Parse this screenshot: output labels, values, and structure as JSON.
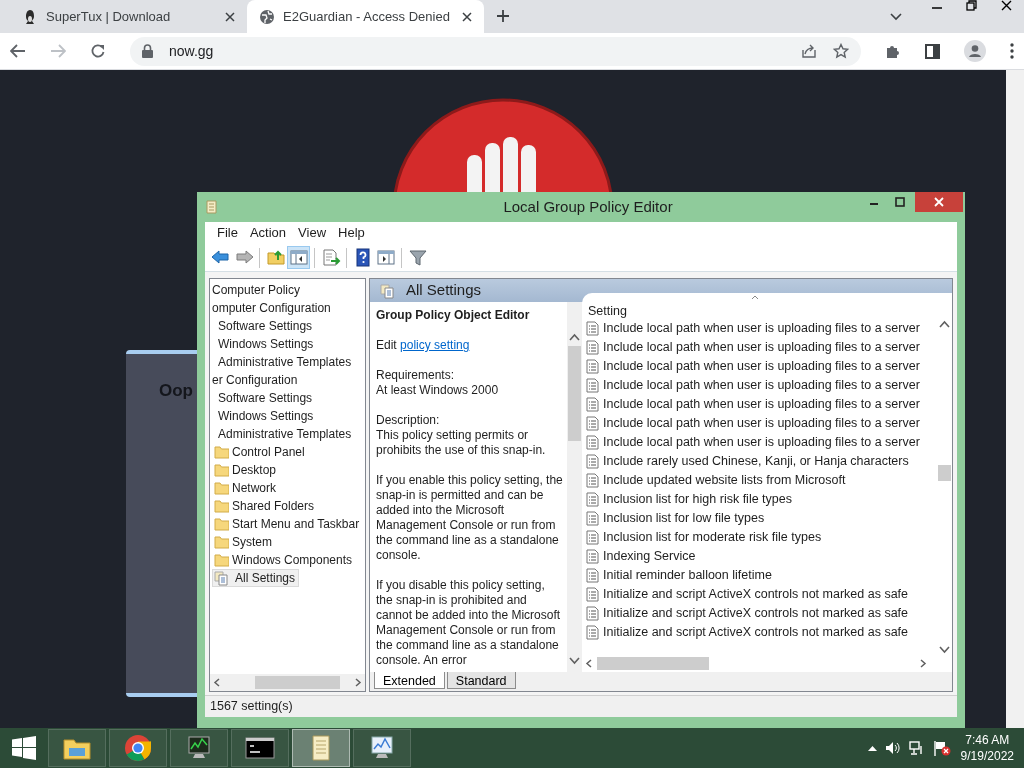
{
  "browser": {
    "tabs": [
      {
        "title": "SuperTux | Download",
        "selected": false,
        "kind": "penguin"
      },
      {
        "title": "E2Guardian - Access Denied",
        "selected": true,
        "kind": "globe"
      }
    ],
    "address": "now.gg"
  },
  "page": {
    "card_heading": "Oop"
  },
  "window": {
    "title": "Local Group Policy Editor",
    "menu": [
      "File",
      "Action",
      "View",
      "Help"
    ],
    "toolbar": [
      [
        {
          "kind": "back",
          "pressed": false
        },
        {
          "kind": "forward",
          "pressed": false
        }
      ],
      [
        {
          "kind": "folder-up",
          "pressed": false
        },
        {
          "kind": "tree-toggle",
          "pressed": true
        }
      ],
      [
        {
          "kind": "export",
          "pressed": false
        }
      ],
      [
        {
          "kind": "help",
          "pressed": false
        },
        {
          "kind": "action-pane",
          "pressed": false
        }
      ],
      [
        {
          "kind": "filter",
          "pressed": false
        }
      ]
    ],
    "tree": [
      {
        "label": "Computer Policy",
        "selected": false,
        "children": [
          {
            "label": "omputer Configuration",
            "selected": false,
            "children": [
              {
                "label": "Software Settings",
                "selected": false
              },
              {
                "label": "Windows Settings",
                "selected": false
              },
              {
                "label": "Administrative Templates",
                "selected": false
              }
            ]
          },
          {
            "label": "er Configuration",
            "selected": false,
            "children": [
              {
                "label": "Software Settings",
                "selected": false
              },
              {
                "label": "Windows Settings",
                "selected": false
              },
              {
                "label": "Administrative Templates",
                "selected": false,
                "children": [
                  {
                    "label": "Control Panel",
                    "selected": false,
                    "kind": "folder"
                  },
                  {
                    "label": "Desktop",
                    "selected": false,
                    "kind": "folder"
                  },
                  {
                    "label": "Network",
                    "selected": false,
                    "kind": "folder"
                  },
                  {
                    "label": "Shared Folders",
                    "selected": false,
                    "kind": "folder"
                  },
                  {
                    "label": "Start Menu and Taskbar",
                    "selected": false,
                    "kind": "folder"
                  },
                  {
                    "label": "System",
                    "selected": false,
                    "kind": "folder"
                  },
                  {
                    "label": "Windows Components",
                    "selected": false,
                    "kind": "folder"
                  },
                  {
                    "label": "All Settings",
                    "selected": true,
                    "kind": "all-settings"
                  }
                ]
              }
            ]
          }
        ]
      }
    ],
    "header": "All Settings",
    "description": {
      "title": "Group Policy Object Editor",
      "edit_prefix": "Edit",
      "edit_link": "policy setting",
      "requirements_label": "Requirements:",
      "requirements": "At least Windows 2000",
      "description_label": "Description:",
      "paragraphs": [
        "This policy setting permits or prohibits the use of this snap-in.",
        "If you enable this policy setting, the snap-in is permitted and can be added into the Microsoft Management Console or run from the command line as a standalone console.",
        "If you disable this policy setting, the snap-in is prohibited and cannot be added into the Microsoft Management Console or run from the command line as a standalone console. An error"
      ]
    },
    "view_tabs": [
      {
        "label": "Extended",
        "selected": true
      },
      {
        "label": "Standard",
        "selected": false
      }
    ],
    "list": {
      "column": "Setting",
      "rows": [
        "Include local path when user is uploading files to a server",
        "Include local path when user is uploading files to a server",
        "Include local path when user is uploading files to a server",
        "Include local path when user is uploading files to a server",
        "Include local path when user is uploading files to a server",
        "Include local path when user is uploading files to a server",
        "Include local path when user is uploading files to a server",
        "Include rarely used Chinese, Kanji, or Hanja characters",
        "Include updated website lists from Microsoft",
        "Inclusion list for high risk file types",
        "Inclusion list for low file types",
        "Inclusion list for moderate risk file types",
        "Indexing Service",
        "Initial reminder balloon lifetime",
        "Initialize and script ActiveX controls not marked as safe",
        "Initialize and script ActiveX controls not marked as safe",
        "Initialize and script ActiveX controls not marked as safe"
      ]
    },
    "status": "1567 setting(s)"
  },
  "taskbar": {
    "apps": [
      {
        "kind": "explorer",
        "selected": false
      },
      {
        "kind": "chrome",
        "selected": false
      },
      {
        "kind": "perfmon",
        "selected": false
      },
      {
        "kind": "cmd",
        "selected": false
      },
      {
        "kind": "gpedit",
        "selected": true
      },
      {
        "kind": "resmon",
        "selected": false
      }
    ],
    "time": "7:46 AM",
    "date": "9/19/2022"
  }
}
